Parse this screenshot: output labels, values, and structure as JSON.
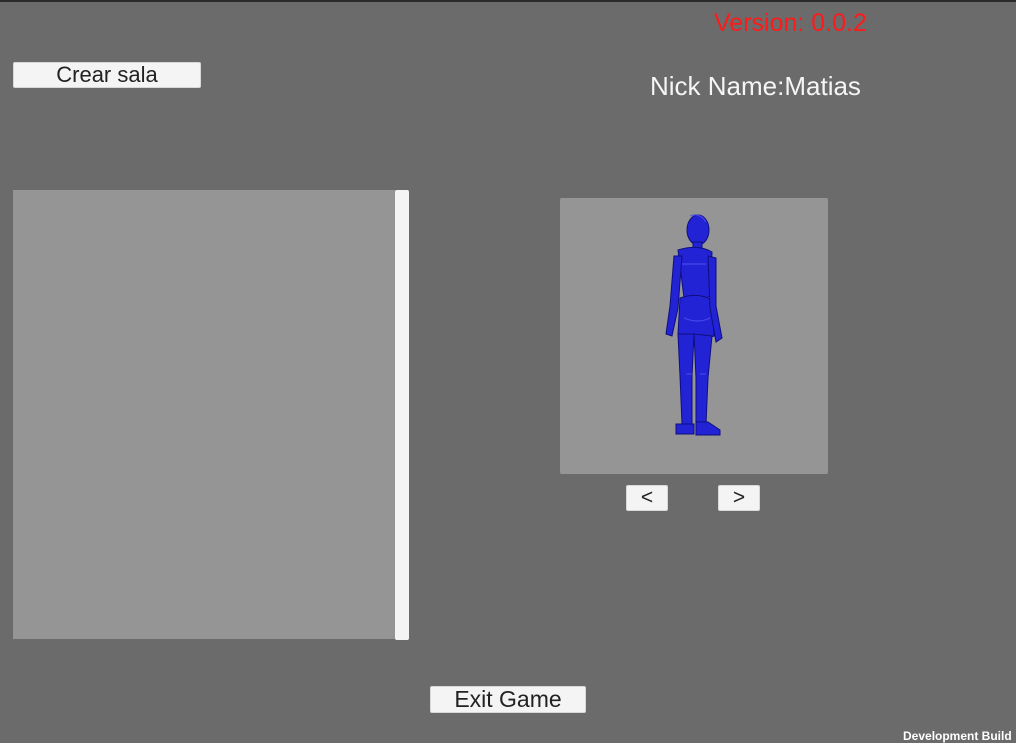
{
  "header": {
    "version": "Version: 0.0.2",
    "nickname": "Nick Name:Matias"
  },
  "lobby": {
    "create_room_label": "Crear sala"
  },
  "character_select": {
    "prev_label": "<",
    "next_label": ">",
    "character_color": "#2323d6"
  },
  "footer": {
    "exit_label": "Exit Game",
    "dev_build": "Development Build"
  },
  "colors": {
    "background": "#6b6b6b",
    "version_text": "#ff1a1a",
    "panel": "#959595"
  }
}
